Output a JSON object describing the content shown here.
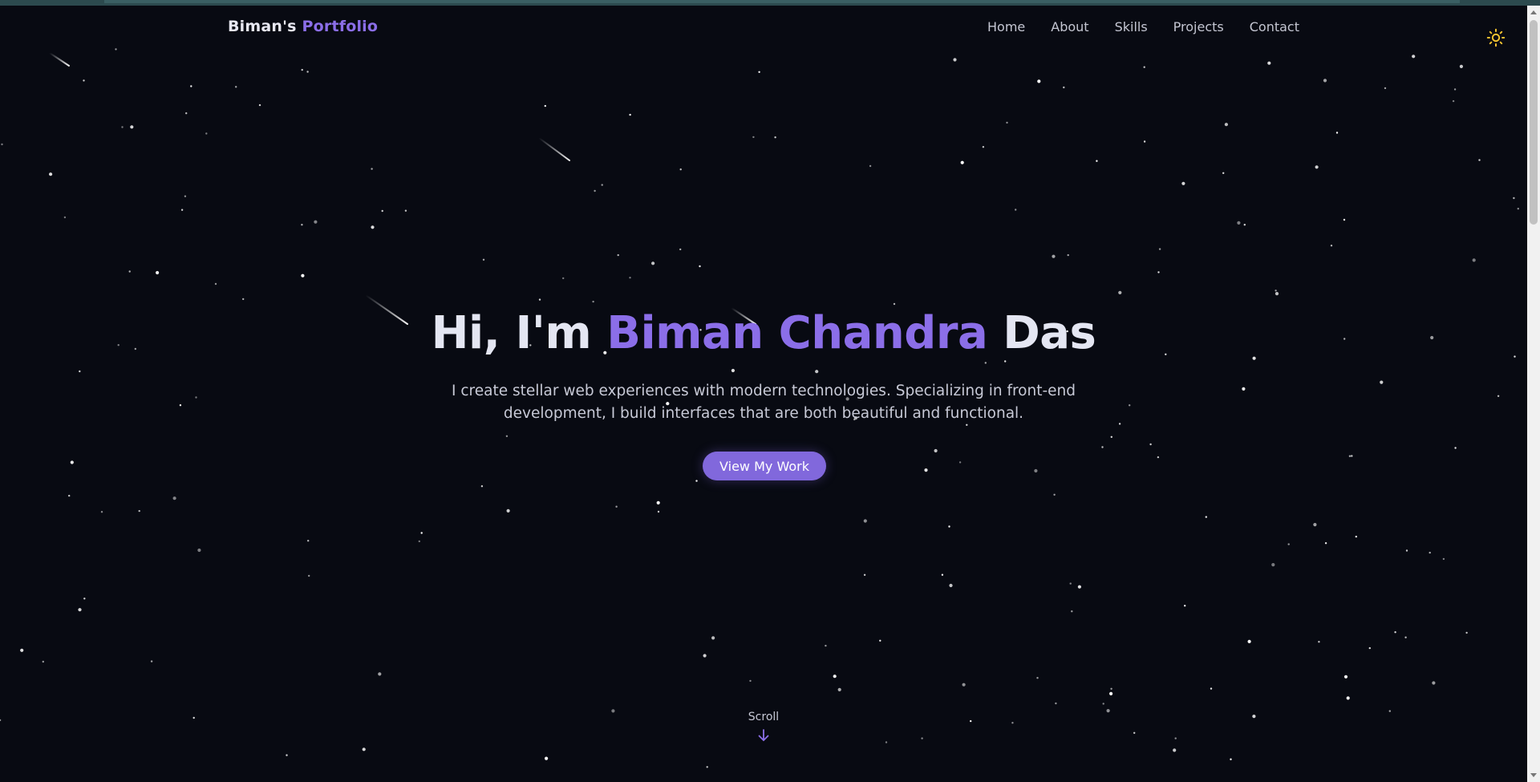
{
  "header": {
    "logo_first": "Biman's",
    "logo_accent": "Portfolio",
    "nav": [
      {
        "label": "Home"
      },
      {
        "label": "About"
      },
      {
        "label": "Skills"
      },
      {
        "label": "Projects"
      },
      {
        "label": "Contact"
      }
    ],
    "theme_toggle_icon": "sun-icon"
  },
  "hero": {
    "title_prefix": "Hi, I'm",
    "title_name": "Biman Chandra",
    "title_suffix": "Das",
    "description": "I create stellar web experiences with modern technologies. Specializing in front-end development, I build interfaces that are both beautiful and functional.",
    "cta_label": "View My Work"
  },
  "scroll": {
    "label": "Scroll",
    "icon": "arrow-down-icon"
  },
  "colors": {
    "background": "#080a12",
    "accent": "#8b6ee8",
    "button": "#8168dc",
    "text": "#e4e6f2",
    "muted_text": "#c7c9d6",
    "sun": "#f2c230"
  }
}
